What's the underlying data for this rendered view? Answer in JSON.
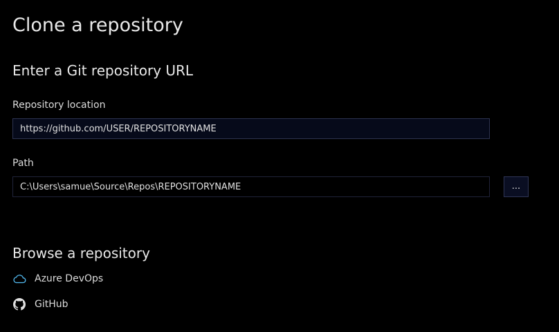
{
  "page": {
    "title": "Clone a repository"
  },
  "git_url_section": {
    "title": "Enter a Git repository URL",
    "repository_location_label": "Repository location",
    "repository_location_value": "https://github.com/USER/REPOSITORYNAME",
    "path_label": "Path",
    "path_value": "C:\\Users\\samue\\Source\\Repos\\REPOSITORYNAME",
    "browse_button_label": "..."
  },
  "browse_section": {
    "title": "Browse a repository",
    "providers": [
      {
        "label": "Azure DevOps",
        "icon": "cloud-icon",
        "icon_color": "#4fb3e8"
      },
      {
        "label": "GitHub",
        "icon": "github-icon",
        "icon_color": "#e0e0e0"
      }
    ]
  },
  "colors": {
    "background": "#000000",
    "text": "#dcdcdc",
    "input_border": "#2d3350"
  }
}
